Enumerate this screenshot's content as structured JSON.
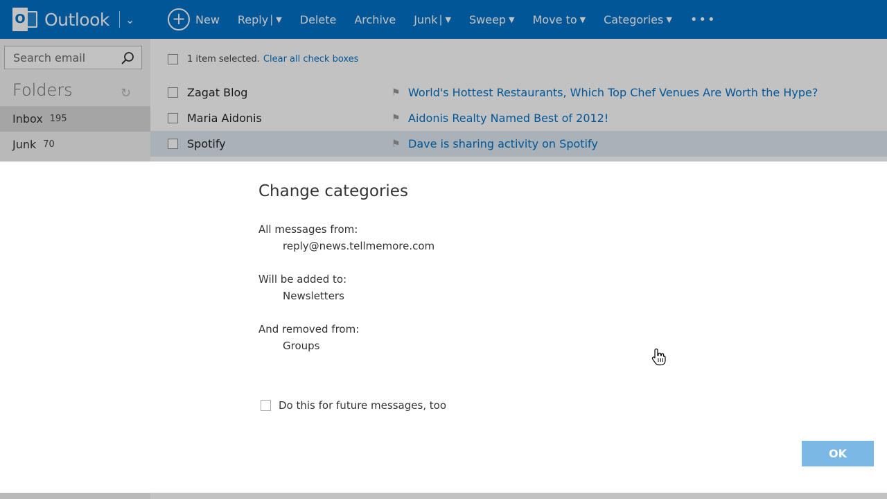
{
  "app": {
    "brand": "Outlook",
    "logo_letter": "O"
  },
  "toolbar": {
    "new_label": "New",
    "reply_label": "Reply",
    "delete_label": "Delete",
    "archive_label": "Archive",
    "junk_label": "Junk",
    "sweep_label": "Sweep",
    "move_label": "Move to",
    "categories_label": "Categories",
    "more_label": "•••"
  },
  "sidebar": {
    "search_placeholder": "Search email",
    "folders_heading": "Folders",
    "items": [
      {
        "label": "Inbox",
        "count": "195"
      },
      {
        "label": "Junk",
        "count": "70"
      }
    ]
  },
  "list": {
    "selection_text": "1 item selected.",
    "clear_link": "Clear all check boxes",
    "rows": [
      {
        "sender": "Zagat Blog",
        "subject": "World's Hottest Restaurants, Which Top Chef Venues Are Worth the Hype?"
      },
      {
        "sender": "Maria Aidonis",
        "subject": "Aidonis Realty Named Best of 2012!"
      },
      {
        "sender": "Spotify",
        "subject": "Dave is sharing activity on Spotify"
      }
    ]
  },
  "dialog": {
    "title": "Change categories",
    "from_label": "All messages from:",
    "from_value": "reply@news.tellmemore.com",
    "added_label": "Will be added to:",
    "added_value": "Newsletters",
    "removed_label": "And removed from:",
    "removed_value": "Groups",
    "future_label": "Do this for future messages, too",
    "ok_label": "OK"
  },
  "colors": {
    "brand_blue": "#0072c6",
    "ok_button": "#7cb8e6"
  }
}
